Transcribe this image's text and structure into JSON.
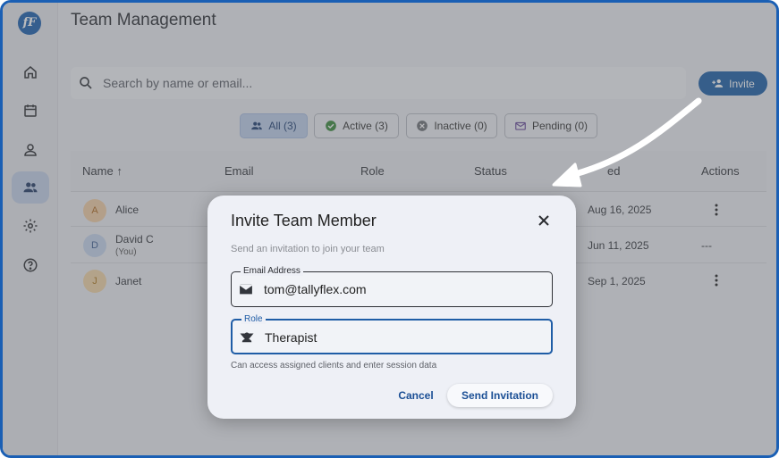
{
  "app": {
    "logo_text": "fF",
    "page_title": "Team Management"
  },
  "sidebar": {
    "items": [
      {
        "icon": "home-icon",
        "active": false
      },
      {
        "icon": "calendar-icon",
        "active": false
      },
      {
        "icon": "person-icon",
        "active": false
      },
      {
        "icon": "team-icon",
        "active": true
      },
      {
        "icon": "gear-icon",
        "active": false
      },
      {
        "icon": "help-icon",
        "active": false
      }
    ]
  },
  "search": {
    "placeholder": "Search by name or email..."
  },
  "toolbar": {
    "invite_label": "Invite"
  },
  "filters": {
    "all": "All (3)",
    "active": "Active (3)",
    "inactive": "Inactive (0)",
    "pending": "Pending (0)"
  },
  "table": {
    "headers": {
      "name": "Name",
      "email": "Email",
      "role": "Role",
      "status": "Status",
      "date": "ed",
      "actions": "Actions"
    },
    "rows": [
      {
        "initial": "A",
        "name": "Alice",
        "sub": "",
        "date": "Aug 16, 2025",
        "actions": "menu"
      },
      {
        "initial": "D",
        "name": "David C",
        "sub": "(You)",
        "date": "Jun 11, 2025",
        "actions": "---"
      },
      {
        "initial": "J",
        "name": "Janet",
        "sub": "",
        "date": "Sep 1, 2025",
        "actions": "menu"
      }
    ]
  },
  "dialog": {
    "title": "Invite Team Member",
    "subtitle": "Send an invitation to join your team",
    "email_label": "Email Address",
    "email_value": "tom@tallyflex.com",
    "role_label": "Role",
    "role_value": "Therapist",
    "helper": "Can access assigned clients and enter session data",
    "cancel_label": "Cancel",
    "send_label": "Send Invitation"
  },
  "colors": {
    "accent": "#1c5fa8",
    "frame_border": "#1a5fb4",
    "active_chip": "#bfd0ec"
  }
}
